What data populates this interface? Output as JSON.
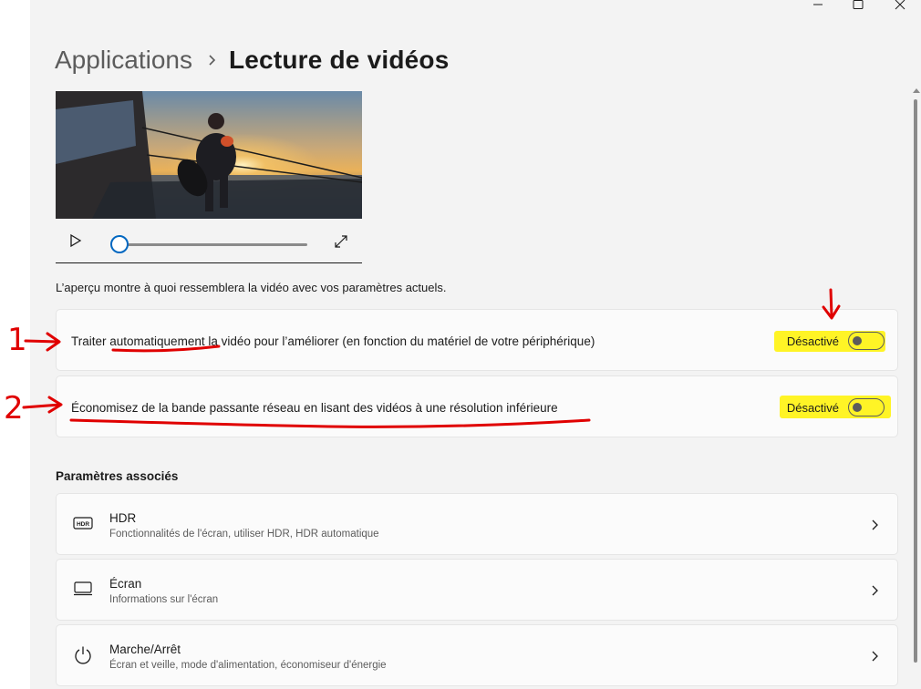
{
  "window": {
    "breadcrumb_parent": "Applications",
    "breadcrumb_separator_icon": "chevron-right-icon",
    "page_title": "Lecture de vidéos",
    "caption_buttons": [
      "minimize-icon",
      "maximize-icon",
      "close-icon"
    ]
  },
  "preview": {
    "image_description_icon": "video-preview-image",
    "play_icon": "play-icon",
    "fullscreen_icon": "fullscreen-icon",
    "seek_position_fraction": 0.0,
    "note": "L’aperçu montre à quoi ressemblera la vidéo avec vos paramètres actuels."
  },
  "settings": [
    {
      "label_prefix": "Traiter ",
      "label_underlined": "automatiquement",
      "label_suffix": " la vidéo pour l’améliorer (en fonction du matériel de votre périphérique)",
      "state": "Désactivé",
      "on": false
    },
    {
      "label": "Économisez de la bande passante réseau en lisant des vidéos à une résolution inférieure",
      "state": "Désactivé",
      "on": false
    }
  ],
  "related": {
    "title": "Paramètres associés",
    "items": [
      {
        "icon": "hdr-icon",
        "title": "HDR",
        "subtitle": "Fonctionnalités de l'écran, utiliser HDR, HDR automatique"
      },
      {
        "icon": "monitor-icon",
        "title": "Écran",
        "subtitle": "Informations sur l'écran"
      },
      {
        "icon": "power-icon",
        "title": "Marche/Arrêt",
        "subtitle": "Écran et veille, mode d'alimentation, économiseur d'énergie"
      }
    ]
  },
  "annotations": {
    "marker_1": "1",
    "marker_2": "2",
    "ink_color": "#e00000",
    "highlight_color": "#fff200"
  },
  "colors": {
    "accent": "#0067c0",
    "window_bg": "#f3f3f3",
    "card_bg": "#fbfbfb"
  }
}
